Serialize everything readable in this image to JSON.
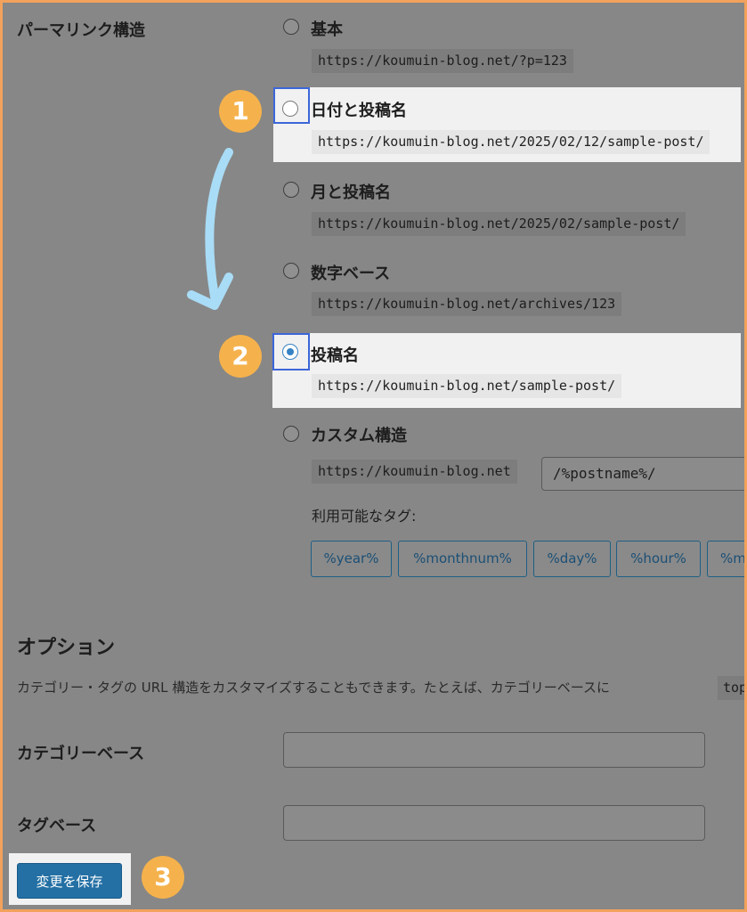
{
  "permalink": {
    "section_label": "パーマリンク構造",
    "options": [
      {
        "label": "基本",
        "example": "https://koumuin-blog.net/?p=123"
      },
      {
        "label": "日付と投稿名",
        "example": "https://koumuin-blog.net/2025/02/12/sample-post/"
      },
      {
        "label": "月と投稿名",
        "example": "https://koumuin-blog.net/2025/02/sample-post/"
      },
      {
        "label": "数字ベース",
        "example": "https://koumuin-blog.net/archives/123"
      },
      {
        "label": "投稿名",
        "example": "https://koumuin-blog.net/sample-post/"
      },
      {
        "label": "カスタム構造",
        "example": "https://koumuin-blog.net"
      }
    ],
    "selected": "投稿名",
    "custom_value": "/%postname%/",
    "available_tags_label": "利用可能なタグ:",
    "tags": [
      "%year%",
      "%monthnum%",
      "%day%",
      "%hour%",
      "%m"
    ]
  },
  "options_section": {
    "heading": "オプション",
    "description": "カテゴリー・タグの URL 構造をカスタマイズすることもできます。たとえば、カテゴリーベースに",
    "description_code": "top",
    "category_base_label": "カテゴリーベース",
    "category_base_value": "",
    "tag_base_label": "タグベース",
    "tag_base_value": ""
  },
  "save_label": "変更を保存",
  "steps": [
    "1",
    "2",
    "3"
  ],
  "colors": {
    "frame_border": "#f2a25c",
    "overlay": "#878787",
    "step_badge": "#f5b24c",
    "arrow": "#a9dcf6",
    "outline": "#3c66d9",
    "radio_selected": "#3582c4",
    "button": "#2470a4"
  }
}
